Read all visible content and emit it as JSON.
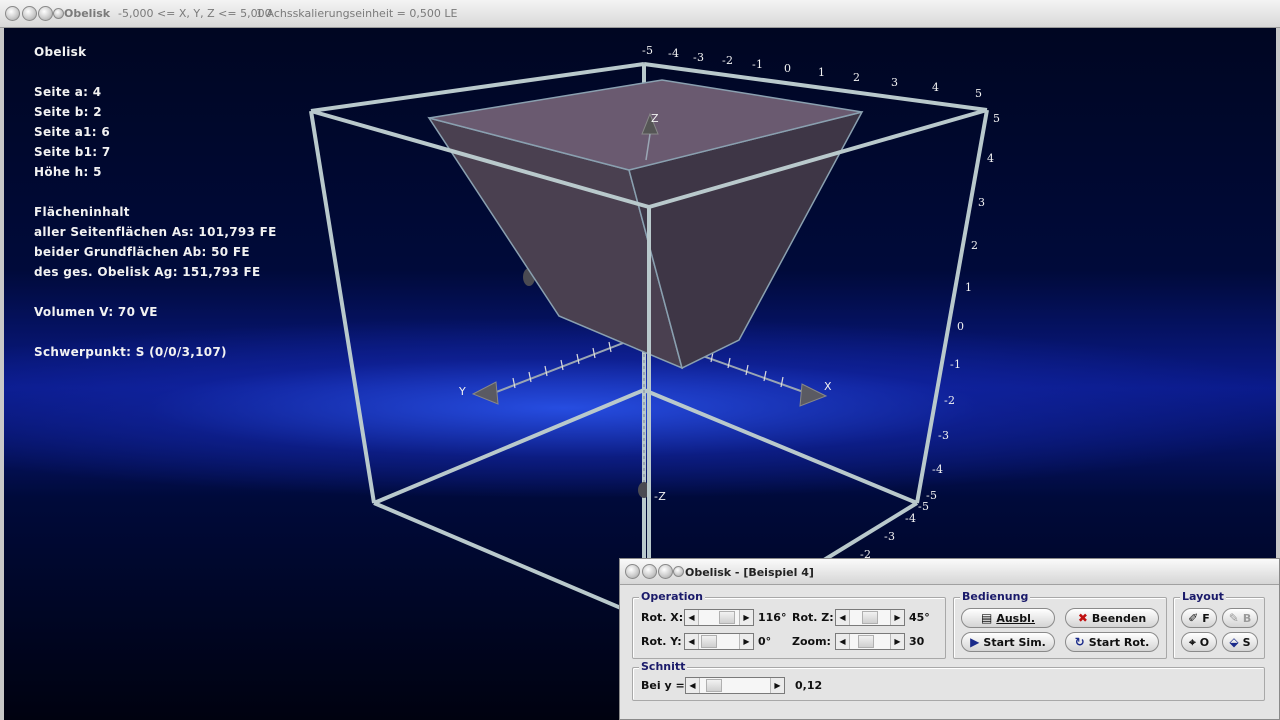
{
  "window": {
    "title": "Obelisk",
    "range": "-5,000 <= X, Y, Z <= 5,000",
    "scale": "1 Achsskalierungseinheit = 0,500 LE"
  },
  "info": {
    "heading": "Obelisk",
    "seite_a": "Seite a: 4",
    "seite_b": "Seite b: 2",
    "seite_a1": "Seite a1: 6",
    "seite_b1": "Seite b1: 7",
    "hoehe": "Höhe h: 5",
    "flaeche_heading": "Flächeninhalt",
    "as": "aller Seitenflächen As: 101,793 FE",
    "ab": "beider Grundflächen Ab: 50 FE",
    "ag": "des ges. Obelisk Ag: 151,793 FE",
    "volumen": "Volumen V: 70 VE",
    "schwerpunkt": "Schwerpunkt: S (0/0/3,107)"
  },
  "axes": {
    "z_label": "Z",
    "neg_z_label": "-Z",
    "x_label": "X",
    "y_label": "Y",
    "top_ticks": [
      "-5",
      "-4",
      "-3",
      "-2",
      "-1",
      "0",
      "1",
      "2",
      "3",
      "4",
      "5"
    ],
    "right_ticks": [
      "5",
      "4",
      "3",
      "2",
      "1",
      "0",
      "-1",
      "-2",
      "-3",
      "-4",
      "-5"
    ],
    "bottom_ticks": [
      "-5",
      "-4",
      "-3",
      "-2"
    ]
  },
  "panel": {
    "title": "Obelisk - [Beispiel 4]",
    "operation": {
      "label": "Operation",
      "rot_x_label": "Rot. X:",
      "rot_x_value": "116°",
      "rot_y_label": "Rot. Y:",
      "rot_y_value": "0°",
      "rot_z_label": "Rot. Z:",
      "rot_z_value": "45°",
      "zoom_label": "Zoom:",
      "zoom_value": "30"
    },
    "bedienung": {
      "label": "Bedienung",
      "ausbl": "Ausbl.",
      "beenden": "Beenden",
      "start_sim": "Start Sim.",
      "start_rot": "Start Rot."
    },
    "layout": {
      "label": "Layout",
      "f": "F",
      "b": "B",
      "o": "O",
      "s": "S"
    },
    "schnitt": {
      "label": "Schnitt",
      "bei_y": "Bei y =",
      "value": "0,12"
    }
  },
  "colors": {
    "frame": "#b9c9cc",
    "solid_top": "#6a5a70",
    "solid_side": "#4a4050",
    "text": "#f2f2f2"
  }
}
